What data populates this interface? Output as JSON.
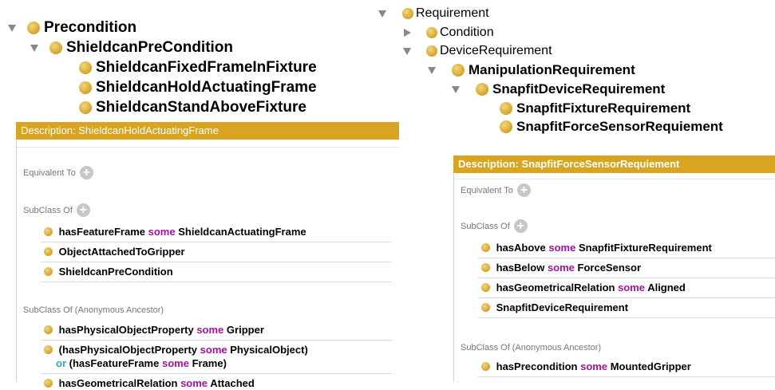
{
  "left_tree": {
    "precondition": "Precondition",
    "shieldcan_precondition": "ShieldcanPreCondition",
    "fixed_frame": "ShieldcanFixedFrameInFixture",
    "hold_frame": "ShieldcanHoldActuatingFrame",
    "stand_above": "ShieldcanStandAboveFixture"
  },
  "right_tree": {
    "requirement": "Requirement",
    "condition": "Condition",
    "device_requirement": "DeviceRequirement",
    "manipulation_requirement": "ManipulationRequirement",
    "snapfit_device_requirement": "SnapfitDeviceRequirement",
    "snapfit_fixture_requirement": "SnapfitFixtureRequirement",
    "snapfit_force_sensor": "SnapfitForceSensorRequiement"
  },
  "left_panel": {
    "header": "Description: ShieldcanHoldActuatingFrame",
    "equivalent_to": "Equivalent To",
    "subclass_of": "SubClass Of",
    "subclass_anon": "SubClass Of (Anonymous Ancestor)",
    "axioms": {
      "a1_prop": "hasFeatureFrame",
      "a1_kw": "some",
      "a1_cls": "ShieldcanActuatingFrame",
      "a2": "ObjectAttachedToGripper",
      "a3": "ShieldcanPreCondition",
      "b1_prop": "hasPhysicalObjectProperty",
      "b1_kw": "some",
      "b1_cls": "Gripper",
      "b2_open": "(hasPhysicalObjectProperty",
      "b2_kw": "some",
      "b2_cls": "PhysicalObject)",
      "b2_or": "or",
      "b2_open2": "(hasFeatureFrame",
      "b2_kw2": "some",
      "b2_cls2": "Frame)",
      "b3_prop": "hasGeometricalRelation",
      "b3_kw": "some",
      "b3_cls": "Attached"
    }
  },
  "right_panel": {
    "header": "Description: SnapfitForceSensorRequiement",
    "equivalent_to": "Equivalent To",
    "subclass_of": "SubClass Of",
    "subclass_anon": "SubClass Of (Anonymous Ancestor)",
    "axioms": {
      "a1_prop": "hasAbove",
      "a1_kw": "some",
      "a1_cls": "SnapfitFixtureRequirement",
      "a2_prop": "hasBelow",
      "a2_kw": "some",
      "a2_cls": "ForceSensor",
      "a3_prop": "hasGeometricalRelation",
      "a3_kw": "some",
      "a3_cls": "Aligned",
      "a4": "SnapfitDeviceRequirement",
      "b1_prop": "hasPrecondition",
      "b1_kw": "some",
      "b1_cls": "MountedGripper"
    }
  },
  "colors": {
    "accent": "#d9a521",
    "keyword": "#a3129f",
    "or_keyword": "#2aa7bf"
  }
}
